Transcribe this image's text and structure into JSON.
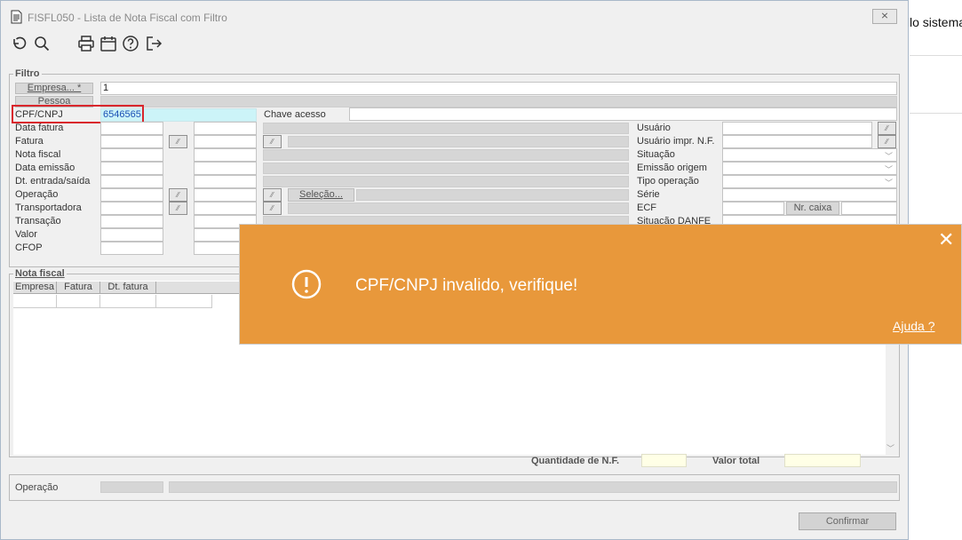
{
  "background": {
    "partial_text": "lo sistema"
  },
  "window": {
    "title": "FISFL050 - Lista de Nota Fiscal com Filtro",
    "close_glyph": "⨯"
  },
  "toolbar": {
    "icons": [
      "undo-icon",
      "search-icon",
      "print-icon",
      "calendar-icon",
      "help-icon",
      "exit-icon"
    ]
  },
  "filtro": {
    "legend": "Filtro",
    "empresa_label": "Empresa... *",
    "empresa_value": "1",
    "pessoa_label": "Pessoa",
    "cpf_label": "CPF/CNPJ",
    "cpf_value": "6546565",
    "chave_label": "Chave acesso",
    "left_labels": [
      "Data fatura",
      "Fatura",
      "Nota fiscal",
      "Data emissão",
      "Dt. entrada/saída",
      "Operação",
      "Transportadora",
      "Transação",
      "Valor",
      "CFOP"
    ],
    "selecao_label": "Seleção...",
    "right_labels": [
      "Usuário",
      "Usuário impr. N.F.",
      "Situação",
      "Emissão origem",
      "Tipo operação",
      "Série",
      "ECF",
      "Situação DANFE"
    ],
    "nr_caixa_label": "Nr. caixa"
  },
  "nota": {
    "legend": "Nota fiscal",
    "columns": [
      "Empresa",
      "Fatura",
      "Dt. fatura"
    ]
  },
  "totals": {
    "quantidade_label": "Quantidade de N.F.",
    "quantidade_value": "",
    "valor_label": "Valor total",
    "valor_value": ""
  },
  "bottom": {
    "operacao_label": "Operação",
    "confirmar_label": "Confirmar"
  },
  "toast": {
    "message": "CPF/CNPJ invalido, verifique!",
    "help_link": "Ajuda ?",
    "close_glyph": "✕",
    "color": "#e8983b"
  },
  "colors": {
    "highlight_border": "#d9262c",
    "field_cyan": "#ccf4f8",
    "field_yellow": "#ffffe6"
  }
}
